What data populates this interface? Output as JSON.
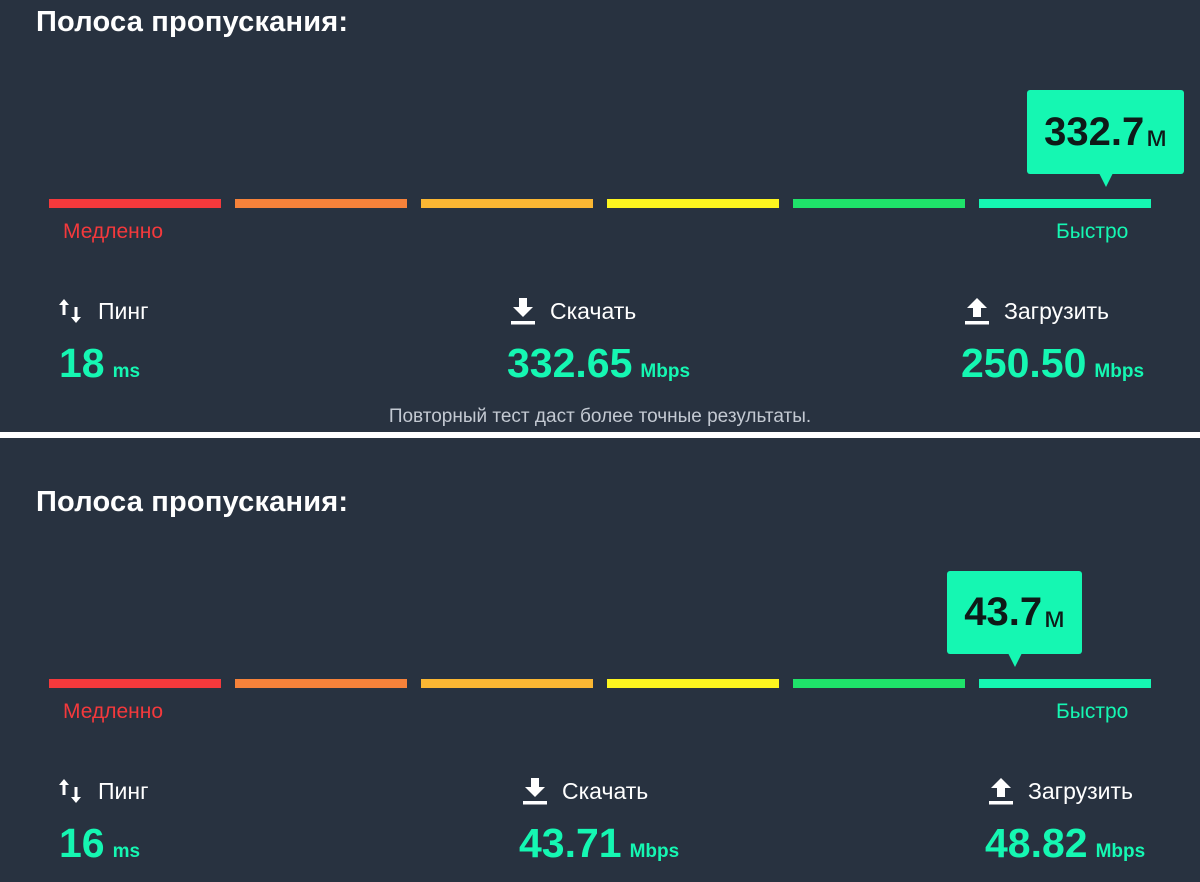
{
  "colors": {
    "background": "#283240",
    "accent": "#15f7b2",
    "slow": "#f4393c",
    "segments": [
      "#f4393c",
      "#f6823a",
      "#fbb733",
      "#fdf51f",
      "#1fe36a",
      "#15f7b2"
    ]
  },
  "panels": [
    {
      "title": "Полоса пропускания:",
      "meter": {
        "bubble_value": "332.7",
        "bubble_unit": "м",
        "level_fraction": 0.96
      },
      "slow_label": "Медленно",
      "fast_label": "Быстро",
      "ping": {
        "label": "Пинг",
        "value": "18",
        "unit": "ms",
        "icon": "up-down-arrows-icon"
      },
      "download": {
        "label": "Скачать",
        "value": "332.65",
        "unit": "Mbps",
        "icon": "download-icon"
      },
      "upload": {
        "label": "Загрузить",
        "value": "250.50",
        "unit": "Mbps",
        "icon": "upload-icon"
      },
      "note": "Повторный тест даст более точные результаты."
    },
    {
      "title": "Полоса пропускания:",
      "meter": {
        "bubble_value": "43.7",
        "bubble_unit": "м",
        "level_fraction": 0.88
      },
      "slow_label": "Медленно",
      "fast_label": "Быстро",
      "ping": {
        "label": "Пинг",
        "value": "16",
        "unit": "ms",
        "icon": "up-down-arrows-icon"
      },
      "download": {
        "label": "Скачать",
        "value": "43.71",
        "unit": "Mbps",
        "icon": "download-icon"
      },
      "upload": {
        "label": "Загрузить",
        "value": "48.82",
        "unit": "Mbps",
        "icon": "upload-icon"
      }
    }
  ]
}
